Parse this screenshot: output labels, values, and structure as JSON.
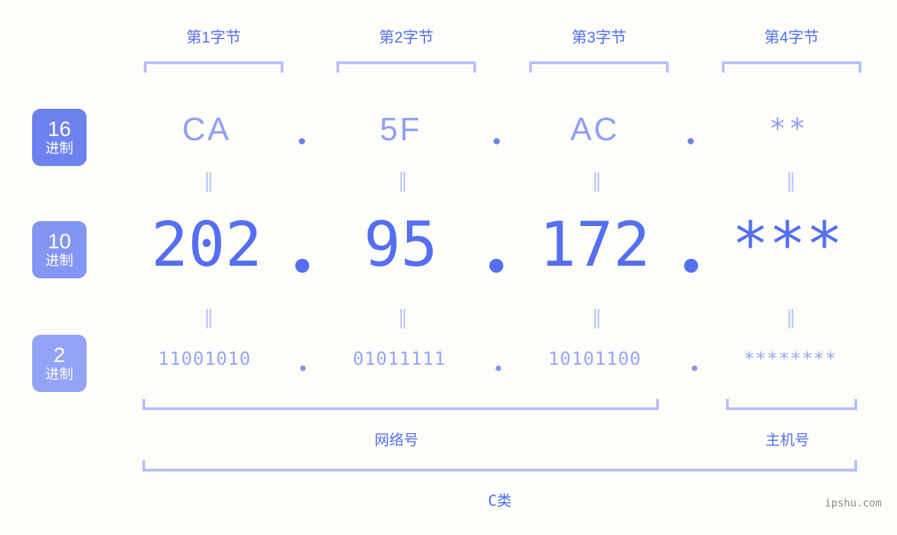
{
  "background_color": "#fdfdfa",
  "accent_color": "#5470f0",
  "muted_accent_color": "#b6c0fb",
  "byte_headers": [
    {
      "label": "第1字节"
    },
    {
      "label": "第2字节"
    },
    {
      "label": "第3字节"
    },
    {
      "label": "第4字节"
    }
  ],
  "radix_badges": [
    {
      "number": "16",
      "unit": "进制",
      "color": "#6e82ef"
    },
    {
      "number": "10",
      "unit": "进制",
      "color": "#8496f3"
    },
    {
      "number": "2",
      "unit": "进制",
      "color": "#93a3f6"
    }
  ],
  "rows": {
    "hex": {
      "values": [
        "CA",
        "5F",
        "AC",
        "**"
      ]
    },
    "dec": {
      "values": [
        "202",
        "95",
        "172",
        "***"
      ]
    },
    "bin": {
      "values": [
        "11001010",
        "01011111",
        "10101100",
        "********"
      ]
    }
  },
  "separator": ".",
  "equals_mark": "‖",
  "sections": [
    {
      "label": "网络号"
    },
    {
      "label": "主机号"
    }
  ],
  "ip_class": {
    "label": "C类"
  },
  "watermark": {
    "text": "ipshu.com"
  }
}
